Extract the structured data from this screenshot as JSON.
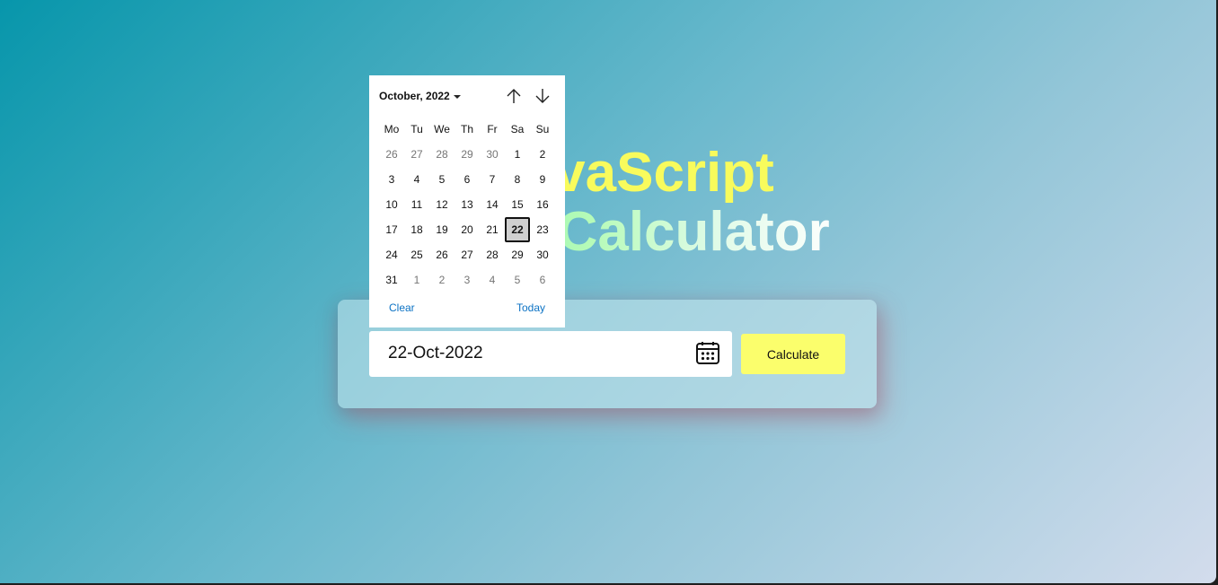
{
  "title": {
    "line1": "JavaScript",
    "line2": "Age Calculator"
  },
  "form": {
    "date_value": "22-Oct-2022",
    "calculate_label": "Calculate"
  },
  "datepicker": {
    "month_label": "October, 2022",
    "weekdays": [
      "Mo",
      "Tu",
      "We",
      "Th",
      "Fr",
      "Sa",
      "Su"
    ],
    "weeks": [
      [
        "26",
        "27",
        "28",
        "29",
        "30",
        "1",
        "2"
      ],
      [
        "3",
        "4",
        "5",
        "6",
        "7",
        "8",
        "9"
      ],
      [
        "10",
        "11",
        "12",
        "13",
        "14",
        "15",
        "16"
      ],
      [
        "17",
        "18",
        "19",
        "20",
        "21",
        "22",
        "23"
      ],
      [
        "24",
        "25",
        "26",
        "27",
        "28",
        "29",
        "30"
      ],
      [
        "31",
        "1",
        "2",
        "3",
        "4",
        "5",
        "6"
      ]
    ],
    "selected_day": "22",
    "clear_label": "Clear",
    "today_label": "Today"
  },
  "colors": {
    "accent_yellow": "#fbfe6c",
    "title_yellow": "#f8fb5c",
    "title_green": "#7ff0a4",
    "link_blue": "#0b72c4"
  },
  "icons": {
    "calendar": "calendar-icon",
    "nav_up": "arrow-up-icon",
    "nav_down": "arrow-down-icon",
    "month_dropdown": "caret-down-icon"
  }
}
